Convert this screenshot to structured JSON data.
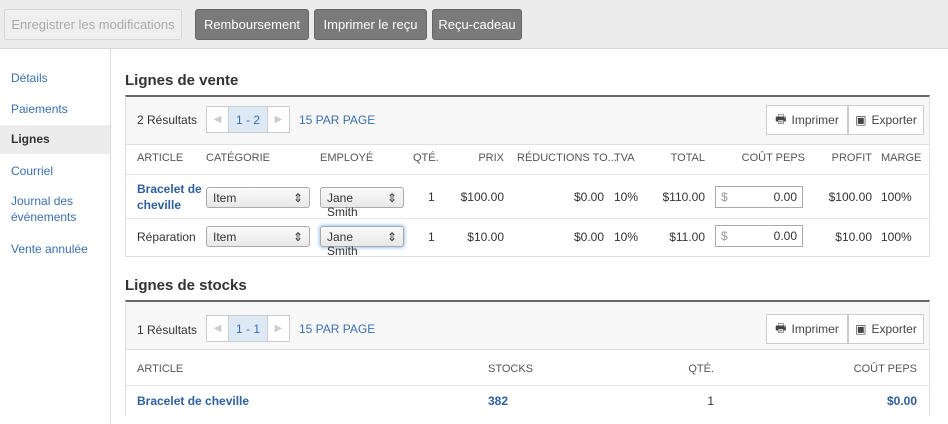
{
  "toolbar": {
    "save": "Enregistrer les modifications",
    "refund": "Remboursement",
    "print_receipt": "Imprimer le reçu",
    "gift_receipt": "Reçu-cadeau"
  },
  "sidebar": {
    "items": [
      {
        "label": "Détails"
      },
      {
        "label": "Paiements"
      },
      {
        "label": "Lignes"
      },
      {
        "label": "Courriel"
      },
      {
        "label": "Journal des événements"
      },
      {
        "label": "Vente annulée"
      }
    ]
  },
  "sales": {
    "title": "Lignes de vente",
    "results": "2 Résultats",
    "page": "1 - 2",
    "per_page": "15 PAR PAGE",
    "print": "Imprimer",
    "export": "Exporter",
    "headers": [
      "ARTICLE",
      "CATÉGORIE",
      "EMPLOYÉ",
      "QTÉ.",
      "PRIX",
      "RÉDUCTIONS TO...",
      "TVA",
      "TOTAL",
      "COÛT PEPS",
      "PROFIT",
      "MARGE"
    ],
    "rows": [
      {
        "article": "Bracelet de cheville",
        "category": "Item",
        "employee": "Jane Smith",
        "qty": "1",
        "price": "$100.00",
        "discount": "$0.00",
        "tax": "10%",
        "total": "$110.00",
        "currency": "$",
        "cost": "0.00",
        "profit": "$100.00",
        "margin": "100%"
      },
      {
        "article": "Réparation",
        "category": "Item",
        "employee": "Jane Smith",
        "qty": "1",
        "price": "$10.00",
        "discount": "$0.00",
        "tax": "10%",
        "total": "$11.00",
        "currency": "$",
        "cost": "0.00",
        "profit": "$10.00",
        "margin": "100%"
      }
    ]
  },
  "stock": {
    "title": "Lignes de stocks",
    "results": "1 Résultats",
    "page": "1 - 1",
    "per_page": "15 PAR PAGE",
    "print": "Imprimer",
    "export": "Exporter",
    "headers": [
      "ARTICLE",
      "STOCKS",
      "QTÉ.",
      "COÛT PEPS"
    ],
    "rows": [
      {
        "article": "Bracelet de cheville",
        "stock": "382",
        "qty": "1",
        "cost": "$0.00"
      }
    ]
  }
}
